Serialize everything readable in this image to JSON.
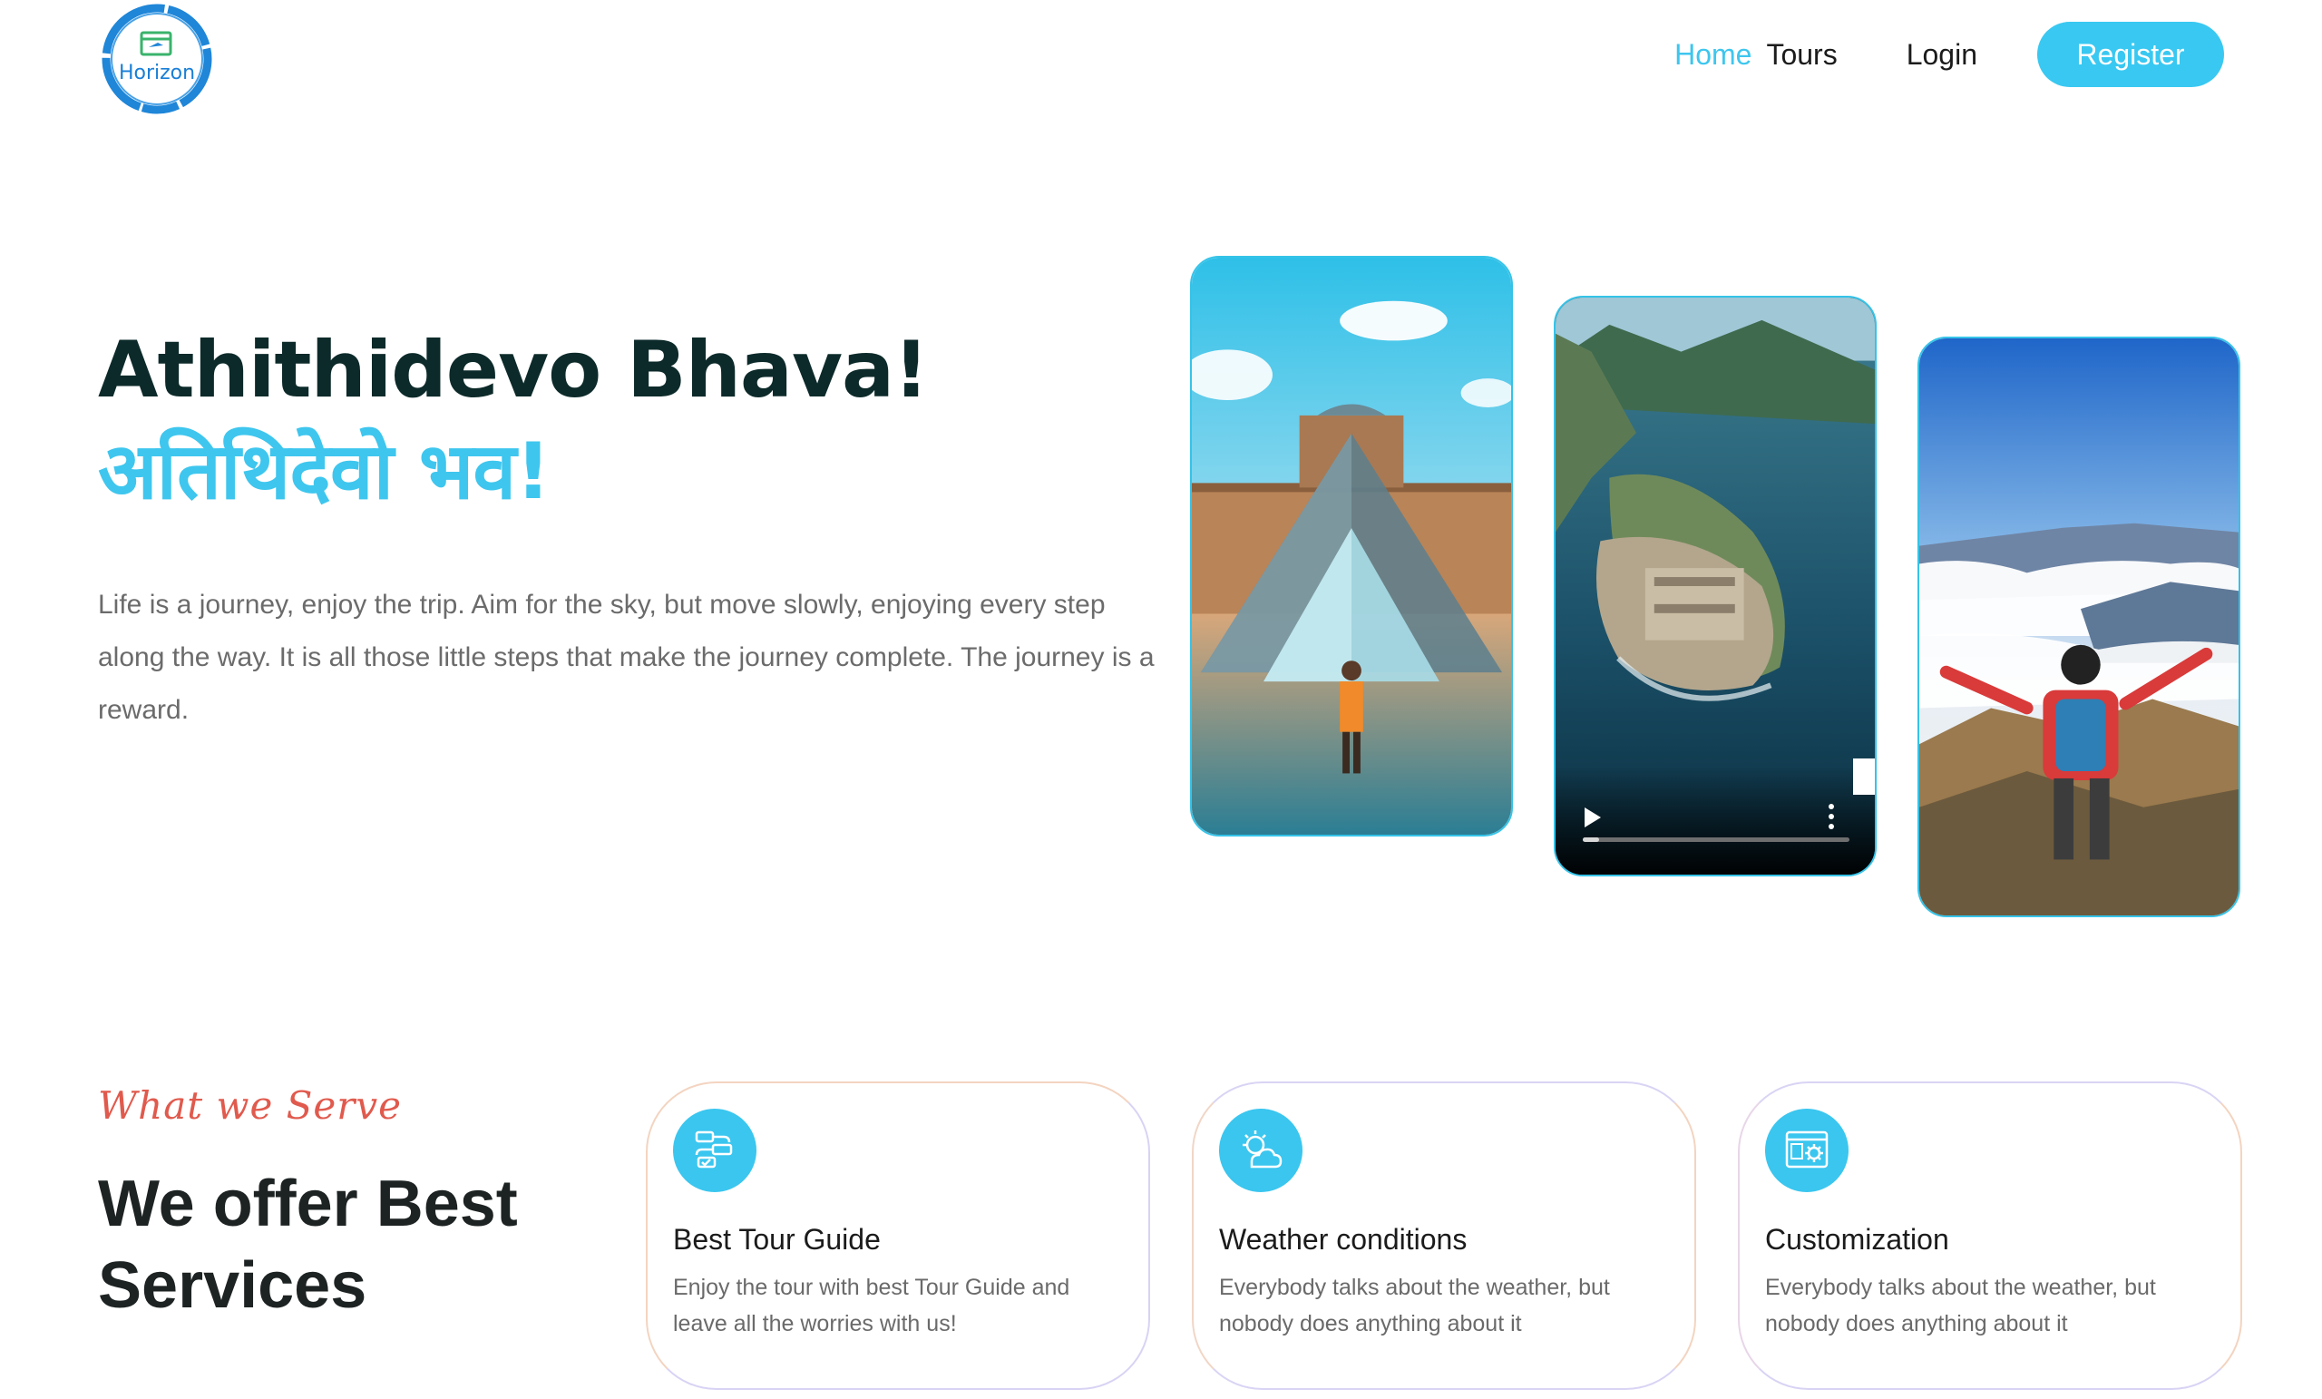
{
  "header": {
    "logo_text": "Horizon",
    "nav": {
      "home": "Home",
      "tours": "Tours",
      "login": "Login",
      "register": "Register"
    }
  },
  "hero": {
    "title_main": "Athithidevo Bhava!",
    "title_accent": "अतिथिदेवो भव!",
    "description": "Life is a journey, enjoy the trip. Aim for the sky, but move slowly, enjoying every step along the way. It is all those little steps that make the journey complete. The journey is a reward.",
    "cards": [
      {
        "image": "louvre-pyramid-traveler"
      },
      {
        "image": "island-fort-aerial-video",
        "video_progress": 0.06
      },
      {
        "image": "hiker-mountain-clouds"
      }
    ]
  },
  "services": {
    "subtitle": "What we Serve",
    "title": "We offer Best Services",
    "items": [
      {
        "icon": "tour-guide-icon",
        "title": "Best Tour Guide",
        "description": "Enjoy the tour with best Tour Guide and leave all the worries with us!"
      },
      {
        "icon": "weather-icon",
        "title": "Weather conditions",
        "description": "Everybody talks about the weather, but nobody does anything about it"
      },
      {
        "icon": "customization-icon",
        "title": "Customization",
        "description": "Everybody talks about the weather, but nobody does anything about it"
      }
    ]
  },
  "colors": {
    "accent": "#3ec6ee",
    "button": "#39c8f1",
    "heading": "#0d2a2a",
    "subtitle_script": "#e05a4d"
  }
}
